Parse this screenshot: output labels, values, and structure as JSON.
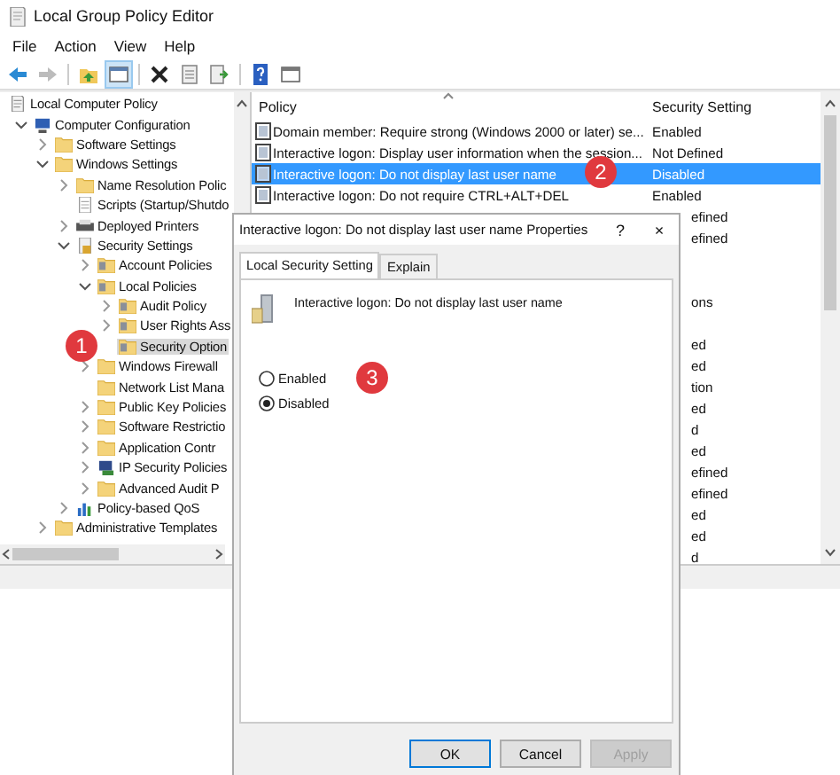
{
  "window": {
    "title": "Local Group Policy Editor"
  },
  "menu": [
    "File",
    "Action",
    "View",
    "Help"
  ],
  "toolbar": [
    [
      {
        "kind": "back",
        "disabled": false,
        "pressed": false
      },
      {
        "kind": "forward",
        "disabled": true,
        "pressed": false
      }
    ],
    [
      {
        "kind": "up",
        "disabled": false,
        "pressed": false
      },
      {
        "kind": "tree",
        "disabled": false,
        "pressed": true
      }
    ],
    [
      {
        "kind": "delete",
        "disabled": false,
        "pressed": false
      },
      {
        "kind": "properties",
        "disabled": false,
        "pressed": false
      },
      {
        "kind": "export",
        "disabled": false,
        "pressed": false
      }
    ],
    [
      {
        "kind": "help",
        "disabled": false,
        "pressed": false
      },
      {
        "kind": "console",
        "disabled": false,
        "pressed": false
      }
    ]
  ],
  "tree": [
    {
      "label": "Local Computer Policy",
      "kind": "document",
      "selected": false,
      "children": [
        {
          "label": "Computer Configuration",
          "kind": "computer",
          "expanded": true,
          "selected": false,
          "children": [
            {
              "label": "Software Settings",
              "kind": "folder",
              "expanded": false,
              "selected": false
            },
            {
              "label": "Windows Settings",
              "kind": "folder",
              "expanded": true,
              "selected": false,
              "children": [
                {
                  "label": "Name Resolution Polic",
                  "kind": "folder",
                  "expanded": false,
                  "selected": false
                },
                {
                  "label": "Scripts (Startup/Shutdo",
                  "kind": "script",
                  "selected": false
                },
                {
                  "label": "Deployed Printers",
                  "kind": "printer",
                  "expanded": false,
                  "selected": false
                },
                {
                  "label": "Security Settings",
                  "kind": "security",
                  "expanded": true,
                  "selected": false,
                  "children": [
                    {
                      "label": "Account Policies",
                      "kind": "policy-folder",
                      "expanded": false,
                      "selected": false
                    },
                    {
                      "label": "Local Policies",
                      "kind": "policy-folder",
                      "expanded": true,
                      "selected": false,
                      "children": [
                        {
                          "label": "Audit Policy",
                          "kind": "policy-folder",
                          "expanded": false,
                          "selected": false
                        },
                        {
                          "label": "User Rights Ass",
                          "kind": "policy-folder",
                          "expanded": false,
                          "selected": false
                        },
                        {
                          "label": "Security Option",
                          "kind": "policy-folder",
                          "selected": true,
                          "badge": "1"
                        }
                      ]
                    },
                    {
                      "label": "Windows Firewall",
                      "kind": "folder",
                      "expanded": false,
                      "selected": false
                    },
                    {
                      "label": "Network List Mana",
                      "kind": "folder",
                      "selected": false
                    },
                    {
                      "label": "Public Key Policies",
                      "kind": "folder",
                      "expanded": false,
                      "selected": false
                    },
                    {
                      "label": "Software Restrictio",
                      "kind": "folder",
                      "expanded": false,
                      "selected": false
                    },
                    {
                      "label": "Application Contr",
                      "kind": "folder",
                      "expanded": false,
                      "selected": false
                    },
                    {
                      "label": "IP Security Policies",
                      "kind": "network",
                      "expanded": false,
                      "selected": false
                    },
                    {
                      "label": "Advanced Audit P",
                      "kind": "folder",
                      "expanded": false,
                      "selected": false
                    }
                  ]
                },
                {
                  "label": "Policy-based QoS",
                  "kind": "chart",
                  "expanded": false,
                  "selected": false
                }
              ]
            },
            {
              "label": "Administrative Templates",
              "kind": "folder",
              "expanded": false,
              "selected": false
            }
          ]
        }
      ]
    }
  ],
  "list": {
    "columns": [
      "Policy",
      "Security Setting"
    ],
    "rows": [
      {
        "kind": "full",
        "policy": "Domain member: Require strong (Windows 2000 or later) se...",
        "setting": "Enabled",
        "selected": false
      },
      {
        "kind": "full",
        "policy": "Interactive logon: Display user information when the session...",
        "setting": "Not Defined",
        "selected": false
      },
      {
        "kind": "full",
        "policy": "Interactive logon: Do not display last user name",
        "setting": "Disabled",
        "selected": true,
        "badge": "2"
      },
      {
        "kind": "full",
        "policy": "Interactive logon: Do not require CTRL+ALT+DEL",
        "setting": "Enabled",
        "selected": false
      },
      {
        "kind": "partial",
        "setting": "efined"
      },
      {
        "kind": "partial",
        "setting": "efined"
      },
      {
        "kind": "blank"
      },
      {
        "kind": "blank"
      },
      {
        "kind": "partial",
        "setting": "ons"
      },
      {
        "kind": "blank"
      },
      {
        "kind": "partial",
        "setting": "ed"
      },
      {
        "kind": "partial",
        "setting": "ed"
      },
      {
        "kind": "partial",
        "setting": "tion"
      },
      {
        "kind": "partial",
        "setting": "ed"
      },
      {
        "kind": "partial",
        "setting": "d"
      },
      {
        "kind": "partial",
        "setting": "ed"
      },
      {
        "kind": "partial",
        "setting": "efined"
      },
      {
        "kind": "partial",
        "setting": "efined"
      },
      {
        "kind": "partial",
        "setting": "ed"
      },
      {
        "kind": "partial",
        "setting": "ed"
      },
      {
        "kind": "partial",
        "setting": "d"
      }
    ]
  },
  "dialog": {
    "title": "Interactive logon: Do not display last user name Properties",
    "help_button": "?",
    "close_button": "×",
    "tabs": [
      {
        "label": "Local Security Setting",
        "selected": true
      },
      {
        "label": "Explain",
        "selected": false
      }
    ],
    "policy_name": "Interactive logon: Do not display last user name",
    "options": [
      {
        "label": "Enabled",
        "selected": false,
        "badge": "3"
      },
      {
        "label": "Disabled",
        "selected": true
      }
    ],
    "buttons": [
      {
        "label": "OK",
        "default": true,
        "disabled": false
      },
      {
        "label": "Cancel",
        "default": false,
        "disabled": false
      },
      {
        "label": "Apply",
        "default": false,
        "disabled": true
      }
    ]
  }
}
